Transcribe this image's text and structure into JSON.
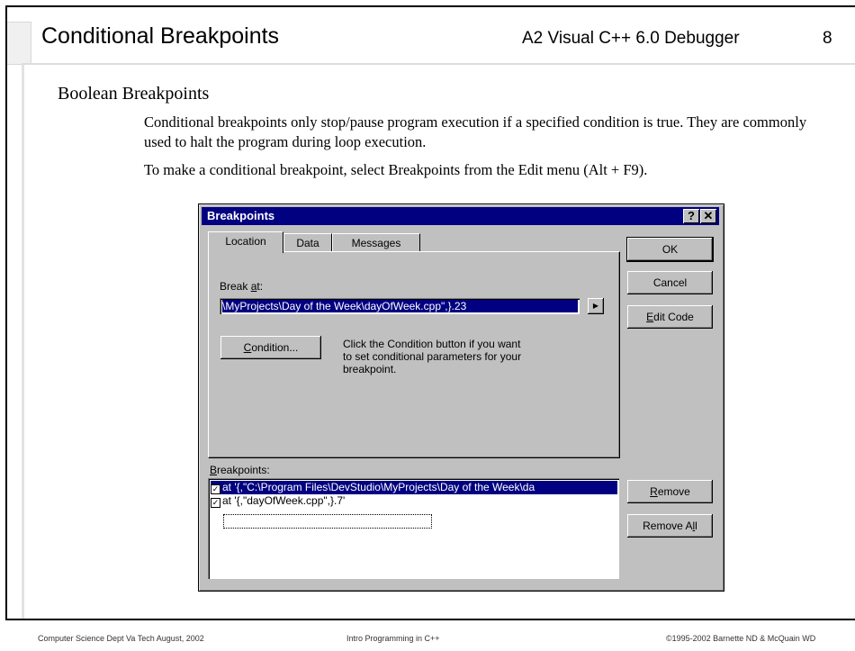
{
  "slide": {
    "title": "Conditional Breakpoints",
    "subtitle": "A2 Visual C++ 6.0 Debugger",
    "page_number": "8",
    "section_heading": "Boolean Breakpoints",
    "paragraph1": "Conditional breakpoints only stop/pause program execution if a specified condition is true. They are commonly used to halt the program during loop execution.",
    "paragraph2": "To make a conditional breakpoint, select Breakpoints from the Edit menu (Alt + F9)."
  },
  "dialog": {
    "title": "Breakpoints",
    "help_glyph": "?",
    "close_glyph": "✕",
    "tabs": [
      {
        "label": "Location"
      },
      {
        "label": "Data"
      },
      {
        "label": "Messages"
      }
    ],
    "break_at_label": "Break at:",
    "break_at_value": "\\MyProjects\\Day of the Week\\dayOfWeek.cpp\",}.23",
    "condition_button": "Condition...",
    "hint_text": "Click the Condition button if you want to set conditional parameters for your breakpoint.",
    "breakpoints_label": "Breakpoints:",
    "breakpoints": [
      {
        "text": "at '{,\"C:\\Program Files\\DevStudio\\MyProjects\\Day of the Week\\da",
        "checked": true,
        "selected": true
      },
      {
        "text": "at '{,\"dayOfWeek.cpp\",}.7'",
        "checked": true,
        "selected": false
      }
    ],
    "buttons": {
      "ok": "OK",
      "cancel": "Cancel",
      "edit_code": "Edit Code",
      "remove": "Remove",
      "remove_all": "Remove All"
    }
  },
  "footer": {
    "left": "Computer Science Dept Va Tech August, 2002",
    "center": "Intro Programming in C++",
    "right": "©1995-2002  Barnette ND & McQuain WD"
  }
}
